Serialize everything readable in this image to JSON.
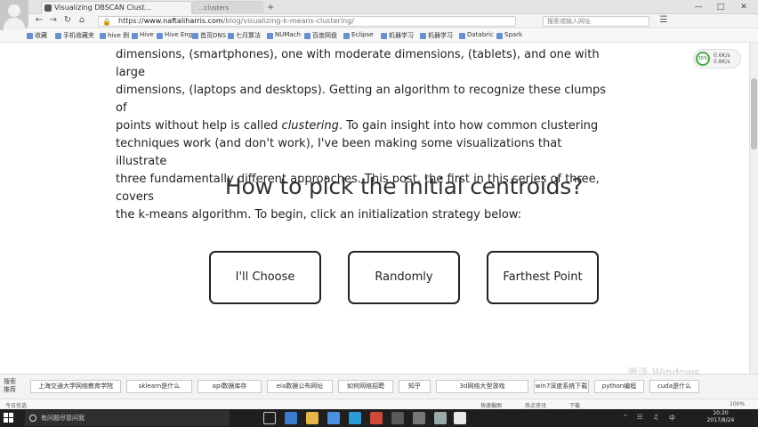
{
  "browser": {
    "tab_title": "Visualizing DBSCAN Clust...",
    "tab2_title": "...clusters",
    "url_host": "www.naftaliharris.com",
    "url_prefix": "https://",
    "url_path": "/blog/visualizing-k-means-clustering/",
    "right_search_placeholder": "搜索或输入网址",
    "bookmarks": [
      "收藏",
      "手机收藏夹",
      "hive 例",
      "Hive",
      "Hive Eng",
      "首页DNS",
      "七月算法",
      "NUMach",
      "百度网盘",
      "Eclipse",
      "机器学习",
      "机器学习",
      "Databric",
      "Spark"
    ]
  },
  "article": {
    "line1": "dimensions, (smartphones), one with moderate dimensions, (tablets), and one with large",
    "line2": "dimensions, (laptops and desktops). Getting an algorithm to recognize these clumps of",
    "line3_pre": "points without help is called ",
    "line3_em": "clustering",
    "line3_post": ". To gain insight into how common clustering",
    "line4": "techniques work (and don't work), I've been making some visualizations that illustrate",
    "line5": "three fundamentally different approaches. This post, the first in this series of three, covers",
    "line6": "the k-means algorithm. To begin, click an initialization strategy below:"
  },
  "heading": "How to pick the initial centroids?",
  "choices": {
    "choose": "I'll Choose",
    "random": "Randomly",
    "farthest": "Farthest Point"
  },
  "widget": {
    "percent": "30%",
    "line1": "0.6K/s",
    "line2": "0.8K/s"
  },
  "watermark": "激活 Windows",
  "hot": {
    "label": "搜索推荐",
    "items": [
      "上海交通大学网络教育学院",
      "sklearn是什么",
      "api数据库存",
      "eia数据公布网址",
      "如何网络招聘",
      "知乎",
      "3d网络大型游戏",
      "win7深度系统下载",
      "python编程",
      "cuda是什么"
    ]
  },
  "status": {
    "left": "今日优选",
    "items": [
      "快速截图",
      "热点资讯",
      "下载",
      "100%"
    ]
  },
  "taskbar": {
    "search_placeholder": "有问题尽管问我",
    "time": "10:20",
    "date": "2017/8/24"
  },
  "colors": {
    "button_border": "#222222",
    "taskbar": "#1f1f1f"
  }
}
